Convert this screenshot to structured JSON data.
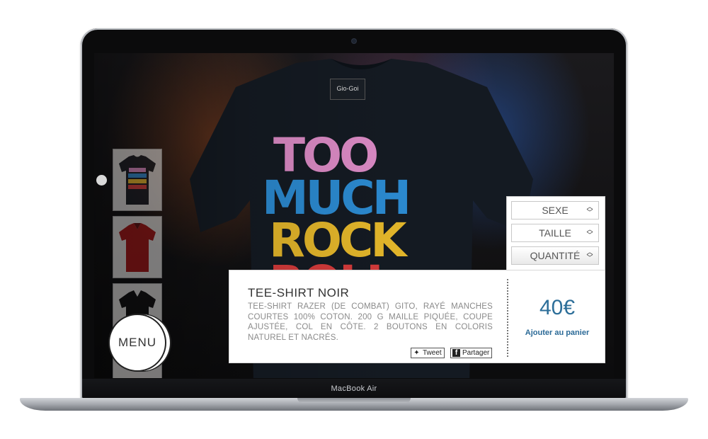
{
  "device": {
    "label": "MacBook Air"
  },
  "product": {
    "title": "TEE-SHIRT NOIR",
    "description": "TEE-SHIRT RAZER (DE COMBAT) GITO, RAYÉ MANCHES COURTES 100% COTON. 200 G MAILLE PIQUÉE, COUPE AJUSTÉE, COL EN CÔTE. 2 BOUTONS EN COLORIS NATUREL ET NACRÉS.",
    "price": "40€",
    "add_to_cart": "Ajouter au panier",
    "share": {
      "tweet": "Tweet",
      "facebook": "Partager"
    }
  },
  "hero_print": {
    "brand_tag": "Gio-Goi",
    "lines": [
      "TOO",
      "MUCH",
      "ROCK",
      "ROLL"
    ]
  },
  "options": {
    "sexe": "SEXE",
    "taille": "TAILLE",
    "quantite": "QUANTITÉ"
  },
  "menu": {
    "label": "MENU"
  },
  "colors": {
    "accent_blue": "#2c6e99",
    "pink": "#d989c3",
    "blue": "#2b89cf",
    "yellow": "#e2b52a",
    "shirt": "#141a22"
  }
}
